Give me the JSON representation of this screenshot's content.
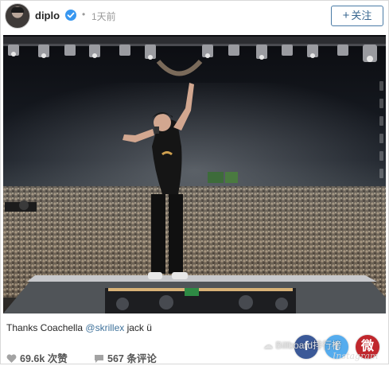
{
  "header": {
    "username": "diplo",
    "verified_icon": "verified-badge-icon",
    "separator": "•",
    "time_ago": "1天前",
    "follow_button": {
      "plus": "+",
      "label": "关注"
    }
  },
  "photo": {
    "description_icon": "concert-stage-photo"
  },
  "caption": {
    "prefix": "Thanks Coachella ",
    "mention": "@skrillex",
    "suffix": " jack ü"
  },
  "footer": {
    "likes_count": "69.6k",
    "likes_label": "次赞",
    "comments_count": "567",
    "comments_label": "条评论"
  },
  "share": {
    "facebook": "f",
    "twitter": "t",
    "weibo": "微"
  },
  "watermark": {
    "text": "Billboard排行榜",
    "sub": "Instagram"
  },
  "colors": {
    "verified": "#3897f0",
    "follow_border": "#4a7ba6",
    "mention": "#3f729b",
    "facebook": "#3b5998",
    "twitter": "#55acee",
    "weibo": "#c0272d"
  }
}
